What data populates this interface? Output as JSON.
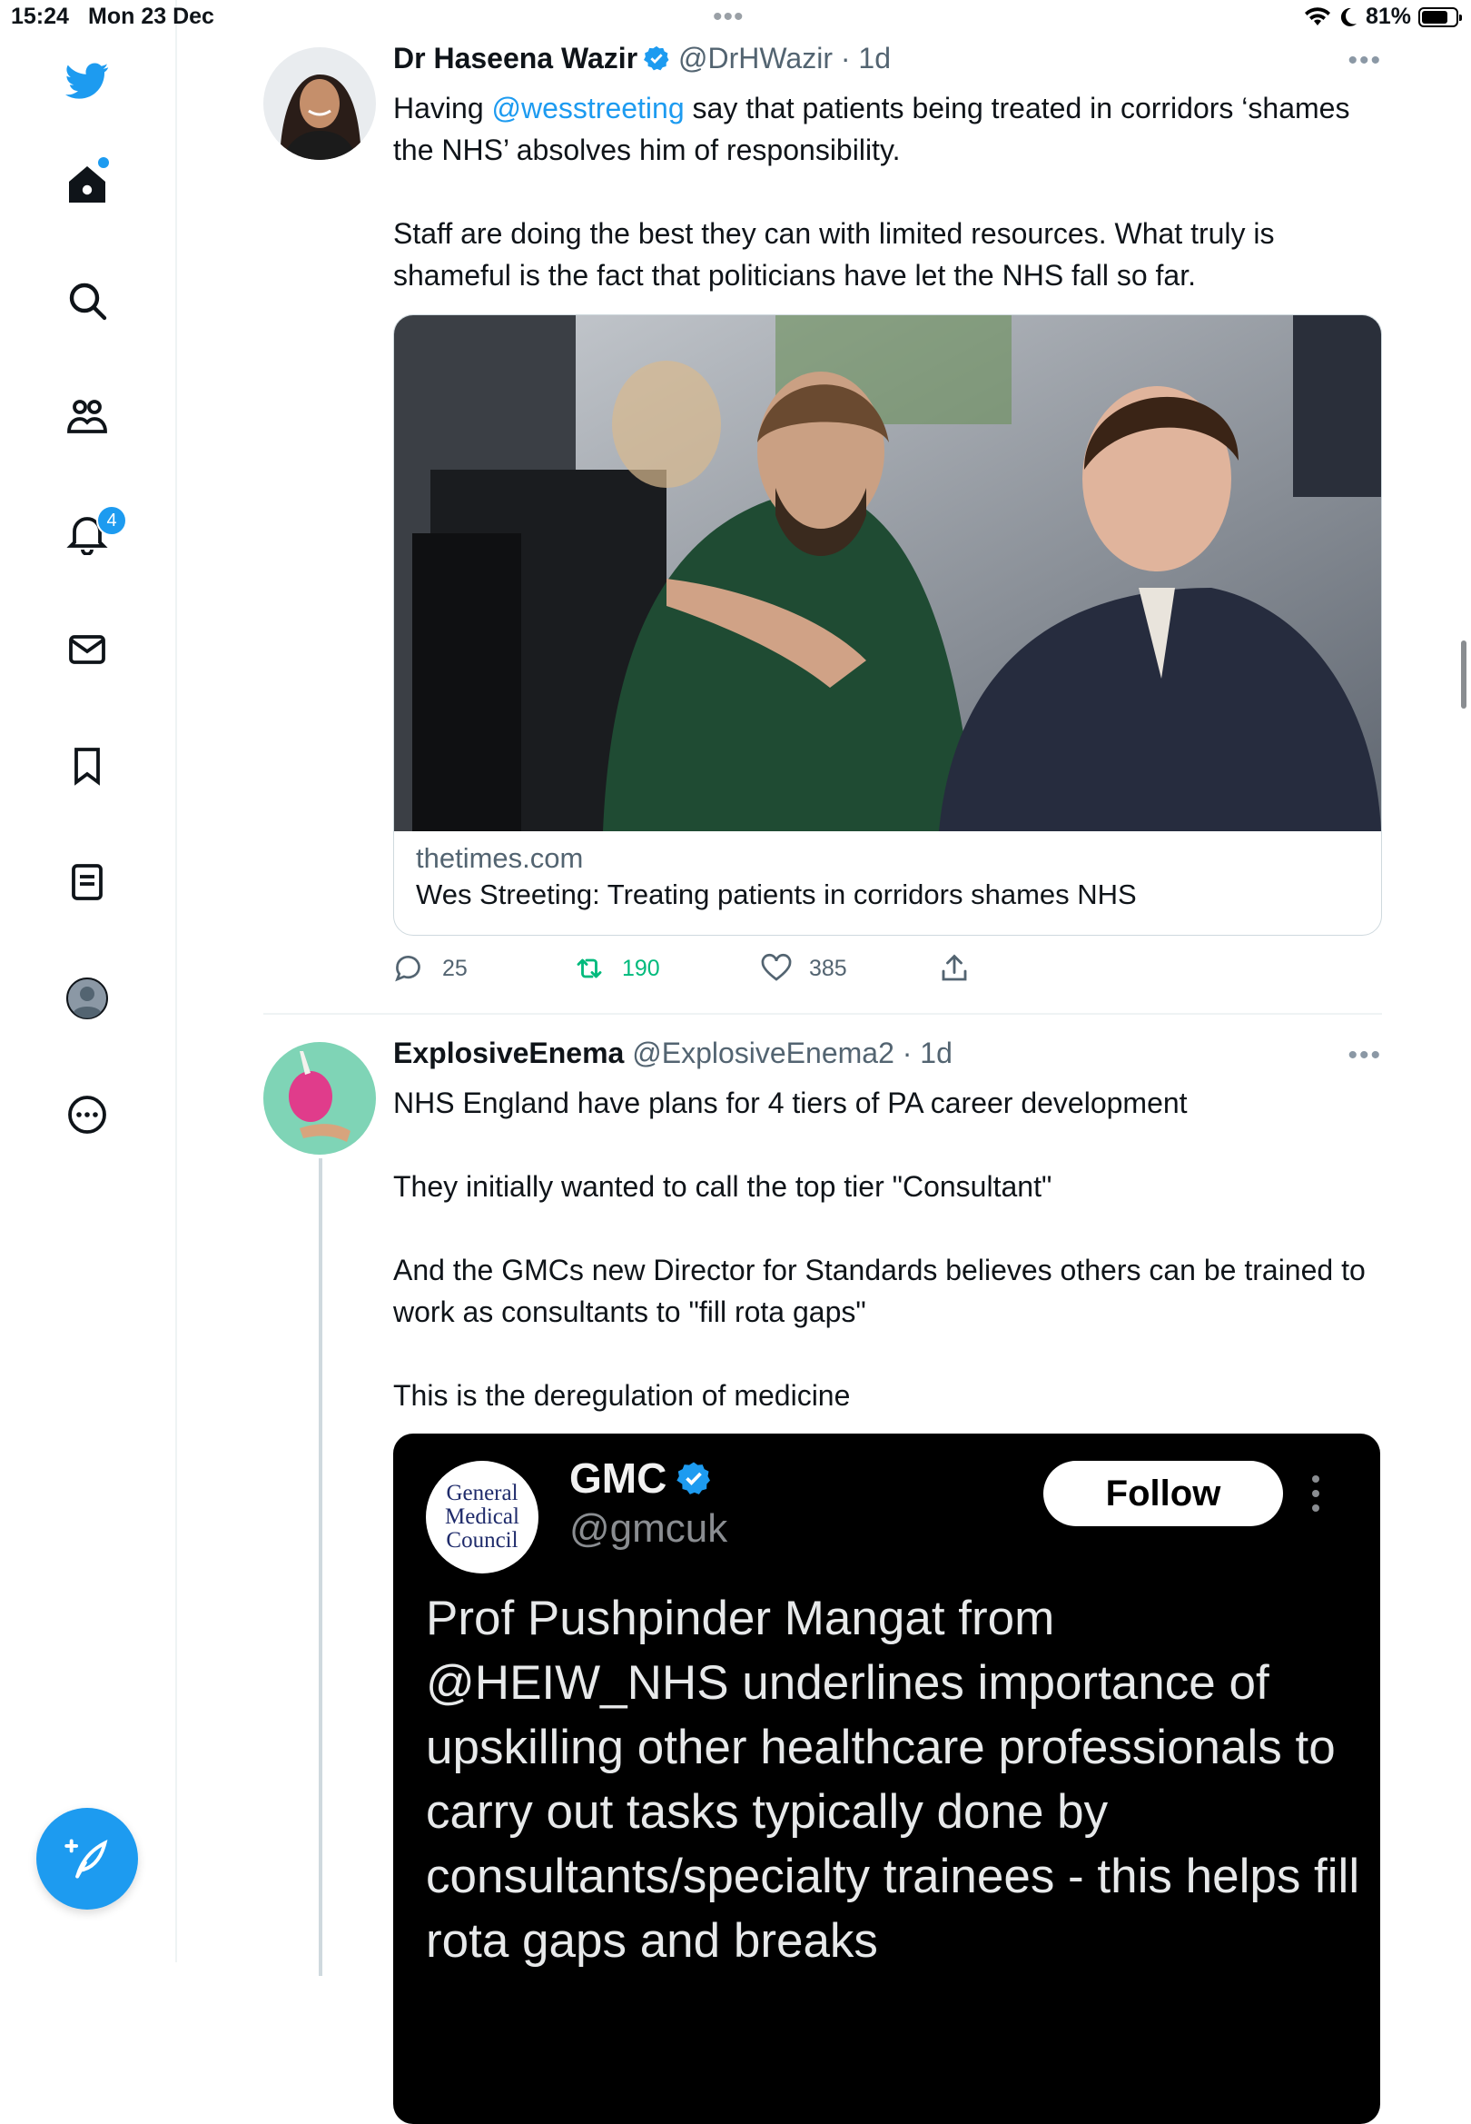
{
  "status_bar": {
    "time": "15:24",
    "date": "Mon 23 Dec",
    "dots": "•••",
    "battery_percent": "81%",
    "battery_level": 0.81
  },
  "sidebar": {
    "items": [
      {
        "icon": "twitter-bird-icon"
      },
      {
        "icon": "home-icon"
      },
      {
        "icon": "search-icon"
      },
      {
        "icon": "communities-icon"
      },
      {
        "icon": "notifications-icon",
        "badge": "4"
      },
      {
        "icon": "messages-icon"
      },
      {
        "icon": "bookmarks-icon"
      },
      {
        "icon": "lists-icon"
      },
      {
        "icon": "profile-icon"
      },
      {
        "icon": "more-icon"
      }
    ],
    "compose_icon": "compose-feather-icon"
  },
  "tweets": [
    {
      "name": "Dr Haseena Wazir",
      "verified": true,
      "handle": "@DrHWazir",
      "time": "1d",
      "text_parts": {
        "pre": "Having ",
        "mention": "@wesstreeting",
        "post": " say that patients being treated in corridors ‘shames the NHS’ absolves him of responsibility.",
        "para2": "Staff are doing the best they can with limited resources. What truly is shameful is the fact that politicians have let the NHS fall so far."
      },
      "card": {
        "domain": "thetimes.com",
        "title": "Wes Streeting: Treating patients in corridors shames NHS"
      },
      "actions": {
        "replies": "25",
        "retweets": "190",
        "likes": "385"
      }
    },
    {
      "name": "ExplosiveEnema",
      "handle": "@ExplosiveEnema2",
      "time": "1d",
      "paragraphs": [
        "NHS England have plans for 4 tiers of PA career development",
        "They initially wanted to call the top tier \"Consultant\"",
        "And the GMCs new Director for Standards believes others can be trained to work as consultants to \"fill rota gaps\"",
        "This is the deregulation of medicine"
      ],
      "embed": {
        "logo_lines": [
          "General",
          "Medical",
          "Council"
        ],
        "name": "GMC",
        "handle": "@gmcuk",
        "follow_label": "Follow",
        "text": "Prof Pushpinder Mangat from @HEIW_NHS underlines importance of upskilling other healthcare professionals to carry out tasks typically done by consultants/specialty trainees - this helps fill rota gaps and breaks"
      }
    }
  ],
  "colors": {
    "accent": "#1d9bf0",
    "retweet": "#00ba7c",
    "secondary_text": "#536471"
  }
}
